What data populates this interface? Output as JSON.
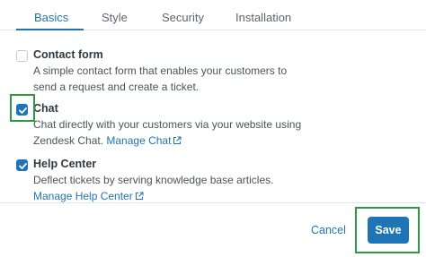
{
  "tabs": [
    {
      "label": "Basics",
      "active": true
    },
    {
      "label": "Style",
      "active": false
    },
    {
      "label": "Security",
      "active": false
    },
    {
      "label": "Installation",
      "active": false
    }
  ],
  "options": [
    {
      "title": "Contact form",
      "checked": false,
      "description": "A simple contact form that enables your customers to send a request and create a ticket."
    },
    {
      "title": "Chat",
      "checked": true,
      "description": "Chat directly with your customers via your website using Zendesk Chat.",
      "link": "Manage Chat"
    },
    {
      "title": "Help Center",
      "checked": true,
      "description": "Deflect tickets by serving knowledge base articles.",
      "link": "Manage Help Center"
    }
  ],
  "footer": {
    "cancel_label": "Cancel",
    "save_label": "Save"
  },
  "colors": {
    "accent": "#1f73b7",
    "highlight": "#2e9b43",
    "text": "#2f3941"
  }
}
